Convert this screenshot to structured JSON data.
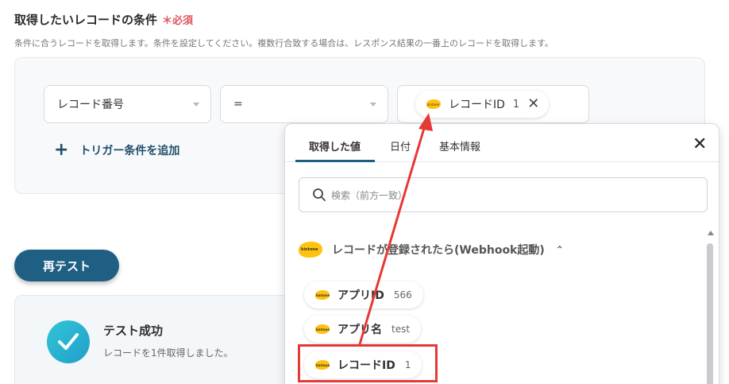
{
  "section": {
    "title": "取得したいレコードの条件",
    "required": "＊必須",
    "description": "条件に合うレコードを取得します。条件を設定してください。複数行合致する場合は、レスポンス結果の一番上のレコードを取得します。"
  },
  "condition": {
    "field": "レコード番号",
    "operator": "=",
    "value_chip": {
      "label": "レコードID",
      "value": "1",
      "close": "✕"
    }
  },
  "add_trigger": {
    "plus": "+",
    "label": "トリガー条件を追加"
  },
  "retest_label": "再テスト",
  "result": {
    "title": "テスト成功",
    "message": "レコードを1件取得しました。"
  },
  "dropdown": {
    "tabs": [
      "取得した値",
      "日付",
      "基本情報"
    ],
    "close": "✕",
    "search_placeholder": "検索（前方一致）",
    "group": {
      "label": "レコードが登録されたら(Webhook起動)",
      "chevron": "⌃"
    },
    "items": [
      {
        "label": "アプリID",
        "value": "566"
      },
      {
        "label": "アプリ名",
        "value": "test"
      },
      {
        "label": "レコードID",
        "value": "1"
      }
    ]
  },
  "colors": {
    "accent": "#1f5f83",
    "required": "#e0555c",
    "highlight": "#e53935",
    "kintone": "#ffc20e"
  },
  "icons": {
    "search": "search-icon",
    "close": "close-icon",
    "check": "check-icon",
    "kintone": "kintone-logo-icon"
  }
}
